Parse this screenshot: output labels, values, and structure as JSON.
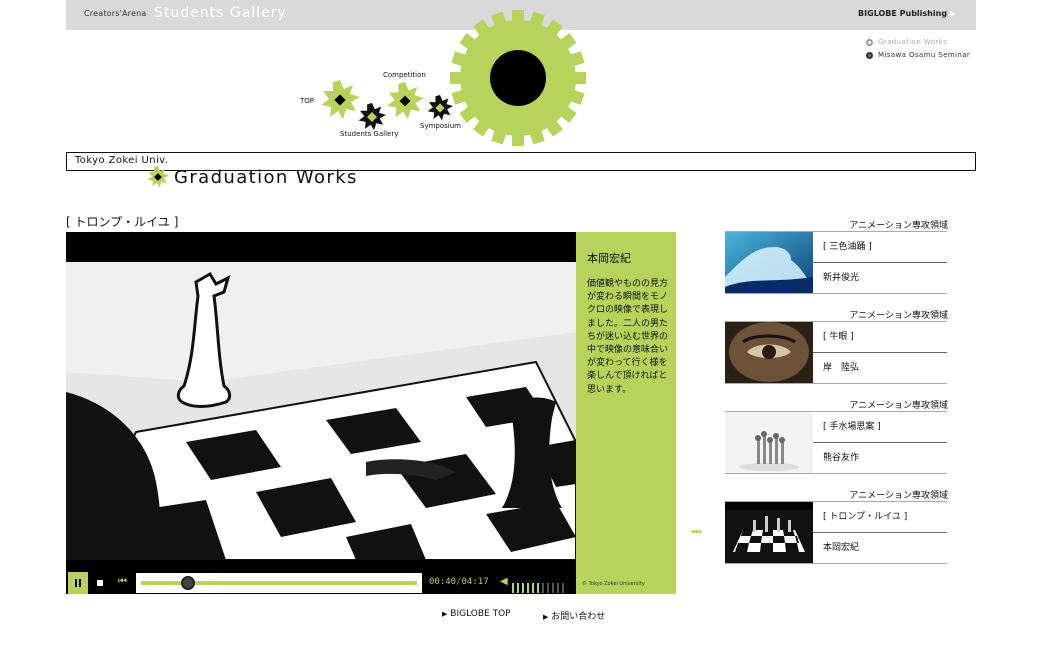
{
  "header": {
    "brand_small": "Creators'Arena",
    "brand_big": "Students Gallery",
    "publisher": "BIGLOBE Publishing"
  },
  "right_links": [
    {
      "label": "Graduation Works",
      "color": "#aaaaaa"
    },
    {
      "label": "Misawa Osamu Seminar",
      "color": "#333333"
    }
  ],
  "nav": {
    "top": "TOP",
    "students_gallery": "Students Gallery",
    "competition": "Competition",
    "symposium": "Symposium"
  },
  "university": "Tokyo Zokei Univ.",
  "section_title": "Graduation Works",
  "work": {
    "title": "[ トロンプ・ルイユ ]",
    "author": "本岡宏紀",
    "description": "価値観やものの見方が変わる瞬間をモノクロの映像で表現しました。二人の男たちが迷い込む世界の中で映像の意味合いが変わって行く様を楽しんで頂ければと思います。",
    "copyright": "© Tokyo Zokei University"
  },
  "player": {
    "time_current": "00:40",
    "time_total": "04:17",
    "progress": 0.17
  },
  "works_list": [
    {
      "category": "アニメーション専攻領域",
      "title": "[ 三色油踊 ]",
      "author": "新井俊光",
      "thumb": "wave"
    },
    {
      "category": "アニメーション専攻領域",
      "title": "[ 牛眼 ]",
      "author": "岸　陸弘",
      "thumb": "eye"
    },
    {
      "category": "アニメーション専攻領域",
      "title": "[ 手水場思案 ]",
      "author": "熊谷友作",
      "thumb": "figures"
    },
    {
      "category": "アニメーション専攻領域",
      "title": "[ トロンプ・ルイユ ]",
      "author": "本岡宏紀",
      "thumb": "chess"
    }
  ],
  "footer": {
    "biglobe_top": "BIGLOBE TOP",
    "contact": "お問い合わせ"
  },
  "colors": {
    "accent": "#b6d35c",
    "topbar": "#d9d9d9",
    "dark": "#000000"
  }
}
